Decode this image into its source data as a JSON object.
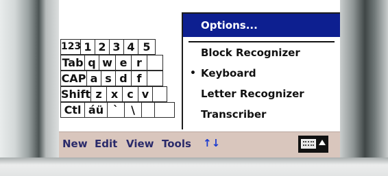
{
  "keyboard": {
    "rows": [
      [
        "123",
        "1",
        "2",
        "3",
        "4",
        "5"
      ],
      [
        "Tab",
        "q",
        "w",
        "e",
        "r",
        ""
      ],
      [
        "CAP",
        "a",
        "s",
        "d",
        "f",
        ""
      ],
      [
        "Shift",
        "z",
        "x",
        "c",
        "v",
        ""
      ],
      [
        "Ctl",
        "áü",
        "`",
        "\\",
        "",
        ""
      ]
    ]
  },
  "menu": {
    "options": "Options...",
    "items": [
      {
        "label": "Block Recognizer",
        "selected": false
      },
      {
        "label": "Keyboard",
        "selected": true
      },
      {
        "label": "Letter Recognizer",
        "selected": false
      },
      {
        "label": "Transcriber",
        "selected": false
      }
    ],
    "bullet": "•"
  },
  "menubar": {
    "items": [
      "New",
      "Edit",
      "View",
      "Tools"
    ],
    "sync_arrows": "↑↓"
  },
  "icons": {
    "input_panel": "keyboard-icon",
    "input_menu_arrow": "triangle-up-icon"
  },
  "colors": {
    "menu_highlight": "#0d1f90",
    "menubar_bg": "#d9c6bd",
    "arrows": "#1a3ad0"
  }
}
